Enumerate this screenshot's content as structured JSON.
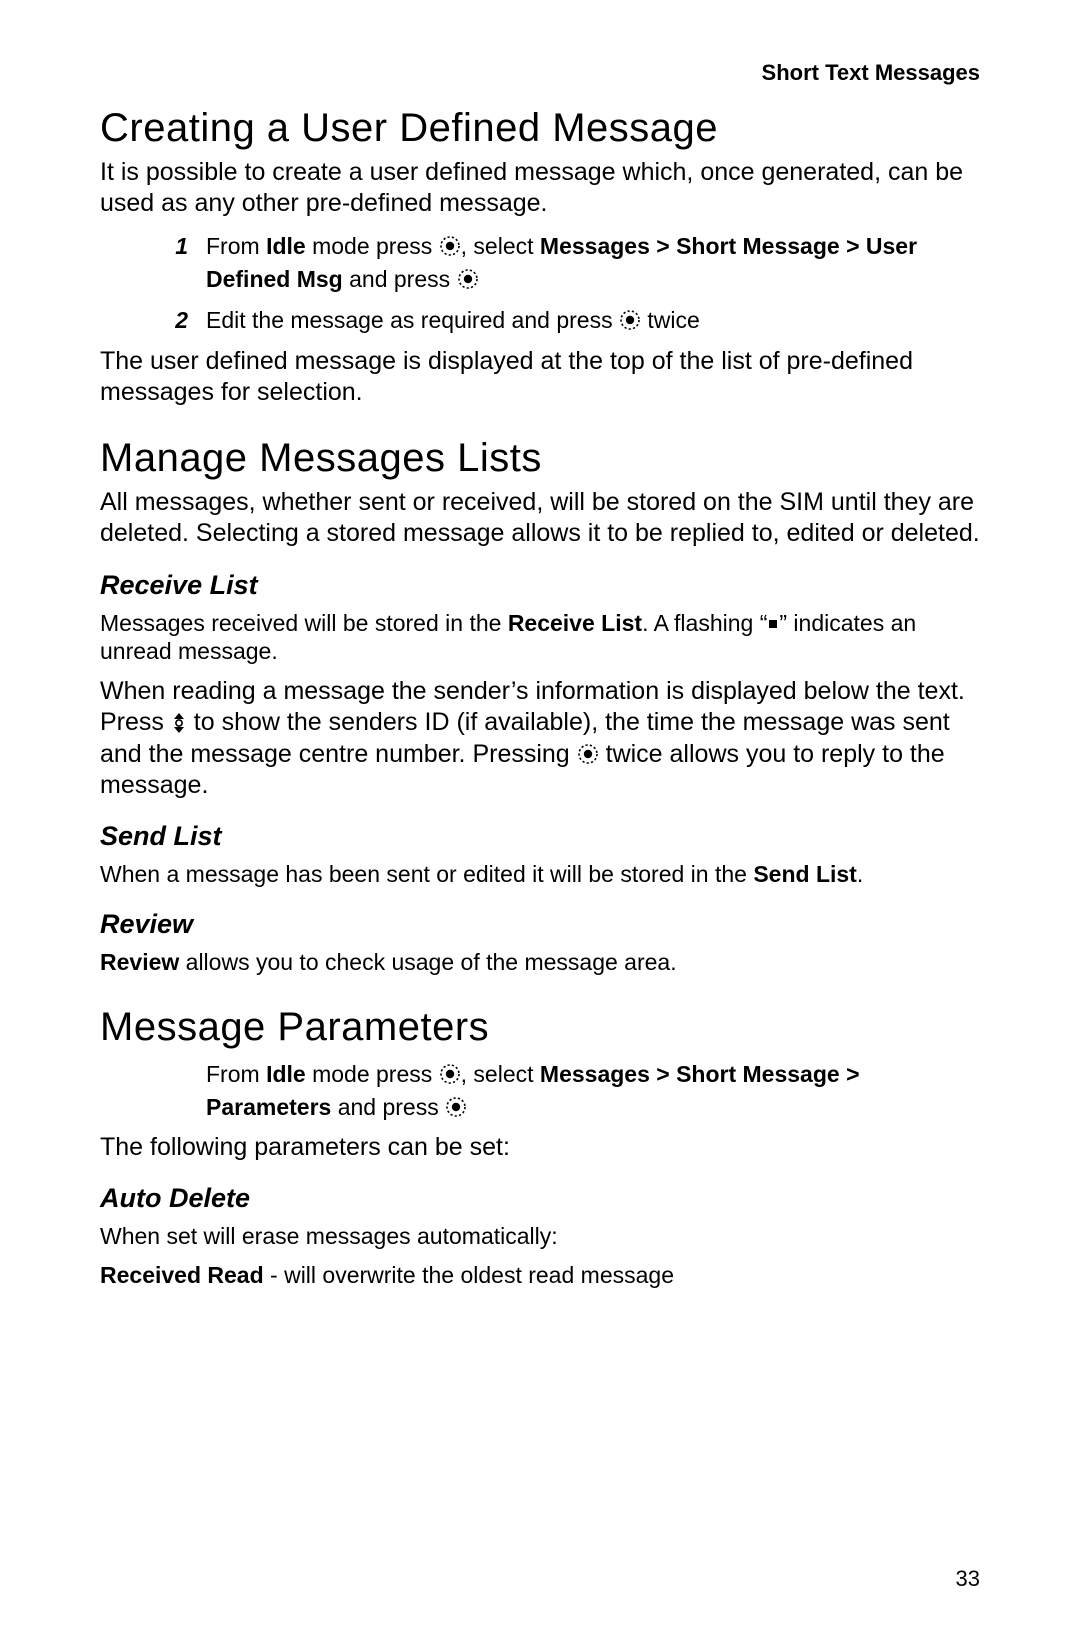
{
  "running_header": "Short Text Messages",
  "page_number": "33",
  "s1": {
    "title": "Creating a User Defined Message",
    "intro": "It is possible to create a user defined message which, once generated, can be used as any other pre-defined message.",
    "step1_num": "1",
    "step1_a": "From ",
    "step1_idle": "Idle",
    "step1_b": " mode press ",
    "step1_c": ", select ",
    "step1_path": "Messages > Short Message > User Defined Msg",
    "step1_d": " and press ",
    "step2_num": "2",
    "step2_a": "Edit the message as required and press ",
    "step2_b": " twice",
    "outro": "The user defined message is displayed at the top of the list of pre-defined messages for selection."
  },
  "s2": {
    "title": "Manage Messages Lists",
    "intro": "All messages, whether sent or received, will be stored on the SIM until they are deleted. Selecting a stored message allows it to be replied to, edited or deleted.",
    "recv": {
      "title": "Receive List",
      "p1_a": "Messages received will be stored in the ",
      "p1_b": "Receive List",
      "p1_c": ". A flashing “",
      "p1_d": "” indicates an unread message.",
      "p2_a": "When reading a message the sender’s information is displayed below the text. Press ",
      "p2_b": " to show the senders ID (if available), the time the message was sent and the message centre number. Pressing ",
      "p2_c": " twice allows you to reply to the message."
    },
    "send": {
      "title": "Send List",
      "p1_a": "When a message has been sent or edited it will be stored in the ",
      "p1_b": "Send List",
      "p1_c": "."
    },
    "review": {
      "title": "Review",
      "p1_a": "Review",
      "p1_b": " allows you to check usage of the message area."
    }
  },
  "s3": {
    "title": "Message Parameters",
    "step_a": "From ",
    "step_idle": "Idle",
    "step_b": " mode press ",
    "step_c": ", select ",
    "step_path": "Messages > Short Message > Parameters",
    "step_d": " and press ",
    "outro": "The following parameters can be set:",
    "auto": {
      "title": "Auto Delete",
      "p1": "When set will erase messages automatically:",
      "p2_a": "Received Read",
      "p2_b": " - will overwrite the oldest read message"
    }
  },
  "icons": {
    "select": "select-button-icon",
    "arrow": "up-down-arrow-icon",
    "square": "unread-indicator-icon"
  }
}
